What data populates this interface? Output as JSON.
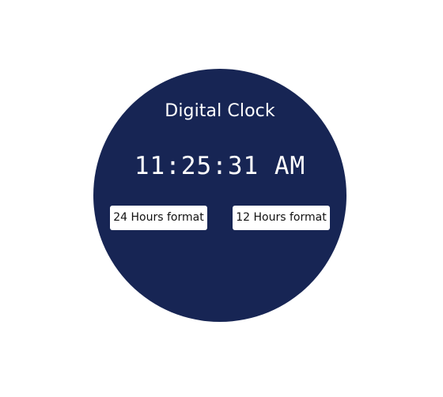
{
  "clock": {
    "title": "Digital Clock",
    "time": "11:25:31 AM",
    "format_24_label": "24 Hours format",
    "format_12_label": "12 Hours format"
  },
  "colors": {
    "face": "#172554",
    "text": "#ffffff",
    "button_background": "#ffffff"
  }
}
